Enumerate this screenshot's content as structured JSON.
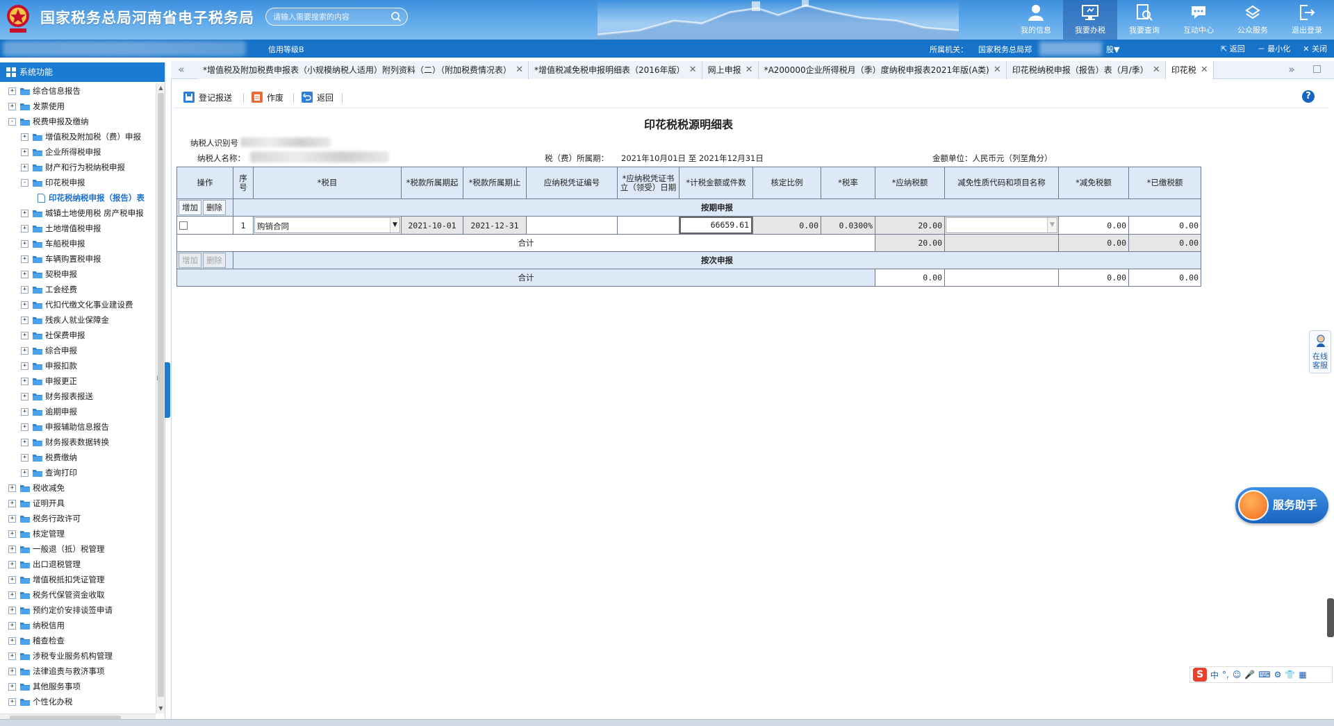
{
  "header": {
    "title": "国家税务总局河南省电子税务局",
    "search_placeholder": "请输入需要搜索的内容",
    "nav": [
      {
        "label": "我的信息",
        "icon": "user-icon"
      },
      {
        "label": "我要办税",
        "icon": "monitor-icon",
        "active": true
      },
      {
        "label": "我要查询",
        "icon": "query-icon"
      },
      {
        "label": "互动中心",
        "icon": "chat-icon"
      },
      {
        "label": "公众服务",
        "icon": "service-icon"
      },
      {
        "label": "退出登录",
        "icon": "logout-icon"
      }
    ]
  },
  "subbar": {
    "credit": "信用等级B",
    "org_label": "所属机关：",
    "org_value": "国家税务总局郑",
    "tax_type": "股▼",
    "back": "返回",
    "minimize": "最小化",
    "close": "关闭"
  },
  "sidebar": {
    "title": "系统功能",
    "items": [
      {
        "label": "综合信息报告",
        "level": 0,
        "expander": "+"
      },
      {
        "label": "发票使用",
        "level": 0,
        "expander": "+"
      },
      {
        "label": "税费申报及缴纳",
        "level": 0,
        "expander": "-"
      },
      {
        "label": "增值税及附加税（费）申报",
        "level": 1,
        "expander": "+"
      },
      {
        "label": "企业所得税申报",
        "level": 1,
        "expander": "+"
      },
      {
        "label": "财产和行为税纳税申报",
        "level": 1,
        "expander": "+"
      },
      {
        "label": "印花税申报",
        "level": 1,
        "expander": "-"
      },
      {
        "label": "印花税纳税申报（报告）表",
        "level": 2,
        "expander": "",
        "selected": true
      },
      {
        "label": "城镇土地使用税 房产税申报",
        "level": 1,
        "expander": "+"
      },
      {
        "label": "土地增值税申报",
        "level": 1,
        "expander": "+"
      },
      {
        "label": "车船税申报",
        "level": 1,
        "expander": "+"
      },
      {
        "label": "车辆购置税申报",
        "level": 1,
        "expander": "+"
      },
      {
        "label": "契税申报",
        "level": 1,
        "expander": "+"
      },
      {
        "label": "工会经费",
        "level": 1,
        "expander": "+"
      },
      {
        "label": "代扣代缴文化事业建设费",
        "level": 1,
        "expander": "+"
      },
      {
        "label": "残疾人就业保障金",
        "level": 1,
        "expander": "+"
      },
      {
        "label": "社保费申报",
        "level": 1,
        "expander": "+"
      },
      {
        "label": "综合申报",
        "level": 1,
        "expander": "+"
      },
      {
        "label": "申报扣款",
        "level": 1,
        "expander": "+"
      },
      {
        "label": "申报更正",
        "level": 1,
        "expander": "+"
      },
      {
        "label": "财务报表报送",
        "level": 1,
        "expander": "+"
      },
      {
        "label": "逾期申报",
        "level": 1,
        "expander": "+"
      },
      {
        "label": "申报辅助信息报告",
        "level": 1,
        "expander": "+"
      },
      {
        "label": "财务报表数据转换",
        "level": 1,
        "expander": "+"
      },
      {
        "label": "税费缴纳",
        "level": 1,
        "expander": "+"
      },
      {
        "label": "查询打印",
        "level": 1,
        "expander": "+"
      },
      {
        "label": "税收减免",
        "level": 0,
        "expander": "+"
      },
      {
        "label": "证明开具",
        "level": 0,
        "expander": "+"
      },
      {
        "label": "税务行政许可",
        "level": 0,
        "expander": "+"
      },
      {
        "label": "核定管理",
        "level": 0,
        "expander": "+"
      },
      {
        "label": "一般退（抵）税管理",
        "level": 0,
        "expander": "+"
      },
      {
        "label": "出口退税管理",
        "level": 0,
        "expander": "+"
      },
      {
        "label": "增值税抵扣凭证管理",
        "level": 0,
        "expander": "+"
      },
      {
        "label": "税务代保管资金收取",
        "level": 0,
        "expander": "+"
      },
      {
        "label": "预约定价安排谈签申请",
        "level": 0,
        "expander": "+"
      },
      {
        "label": "纳税信用",
        "level": 0,
        "expander": "+"
      },
      {
        "label": "稽查检查",
        "level": 0,
        "expander": "+"
      },
      {
        "label": "涉税专业服务机构管理",
        "level": 0,
        "expander": "+"
      },
      {
        "label": "法律追责与救济事项",
        "level": 0,
        "expander": "+"
      },
      {
        "label": "其他服务事项",
        "level": 0,
        "expander": "+"
      },
      {
        "label": "个性化办税",
        "level": 0,
        "expander": "+"
      }
    ]
  },
  "tabs": [
    {
      "label": "*增值税及附加税费申报表（小规模纳税人适用）附列资料（二）（附加税费情况表）",
      "active": false
    },
    {
      "label": "*增值税减免税申报明细表（2016年版）",
      "active": false
    },
    {
      "label": "网上申报",
      "active": false
    },
    {
      "label": "*A200000企业所得税月（季）度纳税申报表2021年版(A类)",
      "active": false
    },
    {
      "label": "印花税纳税申报（报告）表（月/季）",
      "active": false
    },
    {
      "label": "印花税",
      "active": true
    }
  ],
  "toolbar": {
    "submit": "登记报送",
    "void": "作废",
    "back": "返回",
    "help": "?"
  },
  "form": {
    "title": "印花税税源明细表",
    "taxpayer_id_label": "纳税人识别号",
    "taxpayer_name_label": "纳税人名称：",
    "period_label": "税（费）所属期：",
    "period_value": "2021年10月01日 至 2021年12月31日",
    "unit_label": "金额单位：人民币元（列至角分）",
    "columns": [
      "操作",
      "序号",
      "*税目",
      "*税款所属期起",
      "*税款所属期止",
      "应纳税凭证编号",
      "*应纳税凭证书立（领受）日期",
      "*计税金额或件数",
      "核定比例",
      "*税率",
      "*应纳税额",
      "减免性质代码和项目名称",
      "*减免税额",
      "*已缴税额"
    ],
    "add_label": "增加",
    "delete_label": "删除",
    "section_periodic": "按期申报",
    "section_per_time": "按次申报",
    "subtotal_label": "合计",
    "row": {
      "seq": "1",
      "item": "购销合同",
      "start": "2021-10-01",
      "end": "2021-12-31",
      "voucher_no": "",
      "voucher_date": "",
      "amount": "66659.61",
      "ratio": "0.00",
      "rate": "0.0300%",
      "tax": "20.00",
      "relief_code": "",
      "relief_amount": "0.00",
      "paid": "0.00"
    },
    "periodic_total": {
      "tax": "20.00",
      "relief": "0.00",
      "paid": "0.00"
    },
    "per_time_total": {
      "tax": "0.00",
      "relief": "0.00",
      "paid": "0.00"
    }
  },
  "float": {
    "online_cs": "在线客服",
    "assistant": "服务助手",
    "ime_lang": "中"
  }
}
